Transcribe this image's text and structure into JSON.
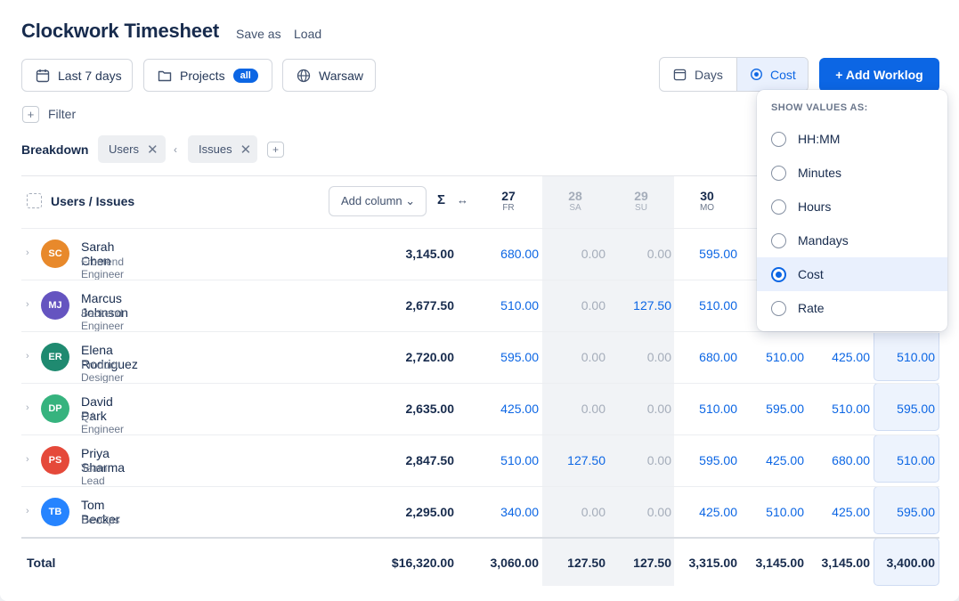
{
  "app": {
    "title": "Clockwork Timesheet",
    "save_as": "Save as",
    "load": "Load"
  },
  "toolbar": {
    "range_label": "Last 7 days",
    "projects_label": "Projects",
    "projects_badge": "all",
    "timezone_label": "Warsaw",
    "days_label": "Days",
    "cost_label": "Cost",
    "add_worklog_label": "+ Add Worklog"
  },
  "filter": {
    "plus": "+",
    "label": "Filter"
  },
  "breakdown": {
    "label": "Breakdown",
    "chips": [
      "Users",
      "Issues"
    ],
    "separator": "‹",
    "plus": "+",
    "remove": "✕"
  },
  "table": {
    "header_label": "Users / Issues",
    "add_column_label": "Add column ⌄",
    "sigma": "Σ",
    "expand": "↔",
    "days": [
      {
        "num": "27",
        "name": "FR",
        "weekend": false
      },
      {
        "num": "28",
        "name": "SA",
        "weekend": true
      },
      {
        "num": "29",
        "name": "SU",
        "weekend": true
      },
      {
        "num": "30",
        "name": "MO",
        "weekend": false
      }
    ],
    "rows": [
      {
        "initials": "SC",
        "name": "Sarah Chen",
        "role": "Frontend Engineer",
        "color": "#e8892b",
        "total": "3,145.00",
        "values": [
          "680.00",
          "0.00",
          "0.00",
          "595.00",
          "",
          "",
          ""
        ]
      },
      {
        "initials": "MJ",
        "name": "Marcus Johnson",
        "role": "Backend Engineer",
        "color": "#6554c0",
        "total": "2,677.50",
        "values": [
          "510.00",
          "0.00",
          "127.50",
          "510.00",
          "",
          "",
          ""
        ]
      },
      {
        "initials": "ER",
        "name": "Elena Rodriguez",
        "role": "Product Designer",
        "color": "#1f8a70",
        "total": "2,720.00",
        "values": [
          "595.00",
          "0.00",
          "0.00",
          "680.00",
          "510.00",
          "425.00",
          "510.00"
        ]
      },
      {
        "initials": "DP",
        "name": "David Park",
        "role": "QA Engineer",
        "color": "#36b37e",
        "total": "2,635.00",
        "values": [
          "425.00",
          "0.00",
          "0.00",
          "510.00",
          "595.00",
          "510.00",
          "595.00"
        ]
      },
      {
        "initials": "PS",
        "name": "Priya Sharma",
        "role": "Team Lead",
        "color": "#e5493a",
        "total": "2,847.50",
        "values": [
          "510.00",
          "127.50",
          "0.00",
          "595.00",
          "425.00",
          "680.00",
          "510.00"
        ]
      },
      {
        "initials": "TB",
        "name": "Tom Becker",
        "role": "DevOps",
        "color": "#2684ff",
        "total": "2,295.00",
        "values": [
          "340.00",
          "0.00",
          "0.00",
          "425.00",
          "510.00",
          "425.00",
          "595.00"
        ]
      }
    ],
    "total_row": {
      "label": "Total",
      "grand": "$16,320.00",
      "values": [
        "3,060.00",
        "127.50",
        "127.50",
        "3,315.00",
        "3,145.00",
        "3,145.00",
        "3,400.00"
      ]
    }
  },
  "dropdown": {
    "heading": "SHOW VALUES AS:",
    "options": [
      {
        "label": "HH:MM",
        "selected": false
      },
      {
        "label": "Minutes",
        "selected": false
      },
      {
        "label": "Hours",
        "selected": false
      },
      {
        "label": "Mandays",
        "selected": false
      },
      {
        "label": "Cost",
        "selected": true
      },
      {
        "label": "Rate",
        "selected": false
      }
    ]
  }
}
